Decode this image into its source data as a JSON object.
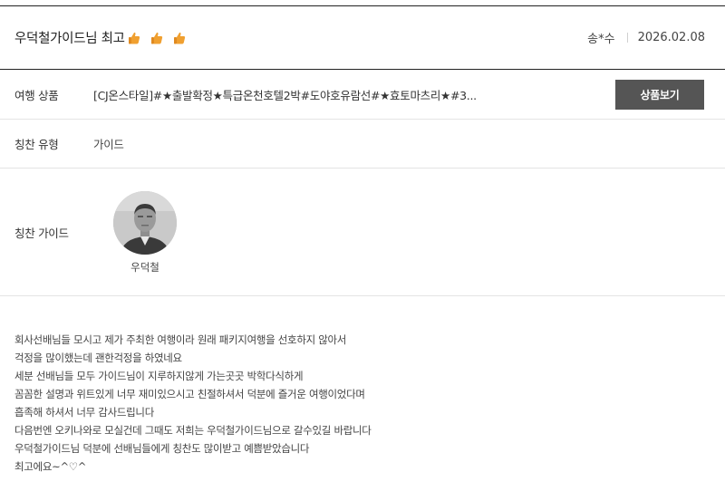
{
  "review": {
    "title": "우덕철가이드님 최고",
    "emoji_icon": "thumbs-up-icon",
    "emoji_count": 3,
    "author": "송*수",
    "date": "2026.02.08"
  },
  "product": {
    "label": "여행 상품",
    "value": "[CJ온스타일]#★출발확정★특급온천호텔2박#도야호유람선#★효토마츠리★#3...",
    "button_label": "상품보기"
  },
  "praise_type": {
    "label": "칭찬 유형",
    "value": "가이드"
  },
  "guide": {
    "label": "칭찬 가이드",
    "name": "우덕철"
  },
  "body": {
    "lines": [
      "회사선배님들 모시고 제가 주최한 여행이라 원래 패키지여행을 선호하지 않아서",
      "걱정을 많이했는데 괜한걱정을 하였네요",
      "세분 선배님들 모두 가이드님이 지루하지않게 가는곳곳 박학다식하게",
      "꼼꼼한 설명과 위트있게 너무 재미있으시고 친절하셔서 덕분에 즐거운 여행이었다며",
      "흡족해 하셔서 너무 감사드립니다",
      "다음번엔 오키나와로 모실건데 그때도 저희는 우덕철가이드님으로 갈수있길 바랍니다",
      "우덕철가이드님 덕분에 선배님들에게 칭찬도 많이받고 예쁨받았습니다",
      "최고에요~^♡^"
    ]
  },
  "colors": {
    "button_bg": "#555555",
    "emoji_fill": "#f0a030"
  }
}
